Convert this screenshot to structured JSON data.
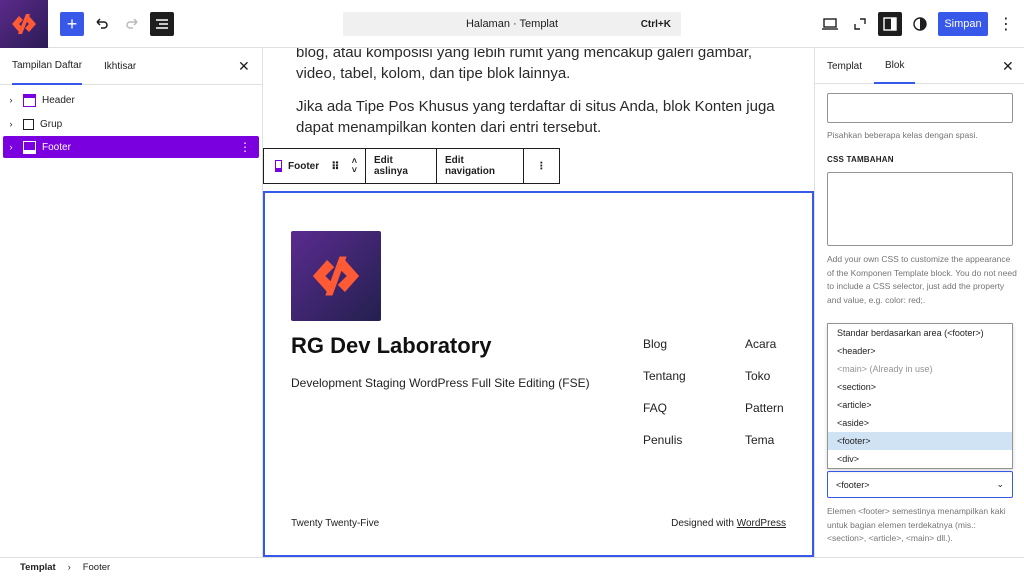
{
  "topbar": {
    "command_title": "Halaman · Templat",
    "command_shortcut": "Ctrl+K",
    "save_label": "Simpan"
  },
  "left_panel": {
    "tabs": [
      "Tampilan Daftar",
      "Ikhtisar"
    ],
    "items": [
      {
        "label": "Header"
      },
      {
        "label": "Grup"
      },
      {
        "label": "Footer"
      }
    ]
  },
  "canvas": {
    "paragraph1": "blog, atau komposisi yang lebih rumit yang mencakup galeri gambar, video, tabel, kolom, dan tipe blok lainnya.",
    "paragraph2": "Jika ada Tipe Pos Khusus yang terdaftar di situs Anda, blok Konten juga dapat menampilkan konten dari entri tersebut.",
    "block_toolbar": {
      "block_label": "Footer",
      "edit_original": "Edit aslinya",
      "edit_navigation": "Edit navigation"
    },
    "footer": {
      "site_title": "RG Dev Laboratory",
      "tagline": "Development Staging WordPress Full Site Editing (FSE)",
      "nav_col1": [
        "Blog",
        "Tentang",
        "FAQ",
        "Penulis"
      ],
      "nav_col2": [
        "Acara",
        "Toko",
        "Pattern",
        "Tema"
      ],
      "theme_credit": "Twenty Twenty-Five",
      "designed_prefix": "Designed with",
      "designed_link": "WordPress"
    }
  },
  "right_panel": {
    "tabs": [
      "Templat",
      "Blok"
    ],
    "class_help": "Pisahkan beberapa kelas dengan spasi.",
    "css_label": "CSS TAMBAHAN",
    "css_help": "Add your own CSS to customize the appearance of the Komponen Template block. You do not need to include a CSS selector, just add the property and value, e.g. color: red;.",
    "options": [
      "Standar berdasarkan area (<footer>)",
      "<header>",
      "<main> (Already in use)",
      "<section>",
      "<article>",
      "<aside>",
      "<footer>",
      "<div>"
    ],
    "selected_value": "<footer>",
    "element_help": "Elemen <footer> semestinya menampilkan kaki untuk bagian elemen terdekatnya (mis.: <section>, <article>, <main> dll.)."
  },
  "breadcrumb": {
    "root": "Templat",
    "current": "Footer"
  },
  "colors": {
    "accent": "#3858e9",
    "selection": "#7a00df",
    "brand": "#ff5a36"
  }
}
